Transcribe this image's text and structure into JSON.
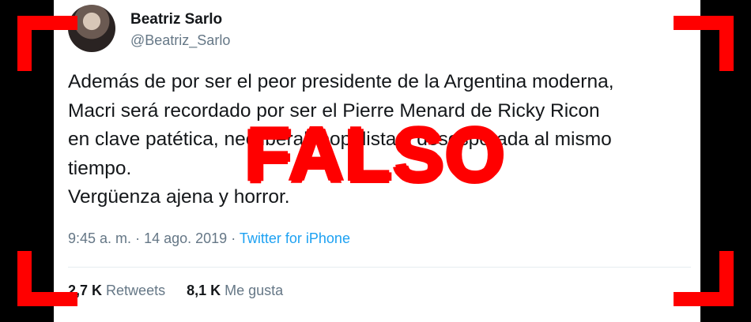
{
  "tweet": {
    "author_name": "Beatriz Sarlo",
    "author_handle": "@Beatriz_Sarlo",
    "text_lines": [
      "Además de por ser el peor presidente de la Argentina moderna,",
      "Macri será recordado por ser el Pierre Menard de Ricky Ricon",
      "en clave patética, neoliberal, populista y desesperada al mismo",
      "tiempo.",
      "Vergüenza ajena y horror."
    ],
    "time": "9:45 a. m.",
    "separator": "·",
    "date": "14 ago. 2019",
    "source": "Twitter for iPhone",
    "retweets_count": "2,7 K",
    "retweets_label": "Retweets",
    "likes_count": "8,1 K",
    "likes_label": "Me gusta"
  },
  "overlay": {
    "stamp_text": "FALSO",
    "stamp_color": "#ff0000"
  },
  "colors": {
    "text": "#14171a",
    "secondary": "#657786",
    "link": "#1da1f2",
    "frame": "#000000"
  }
}
